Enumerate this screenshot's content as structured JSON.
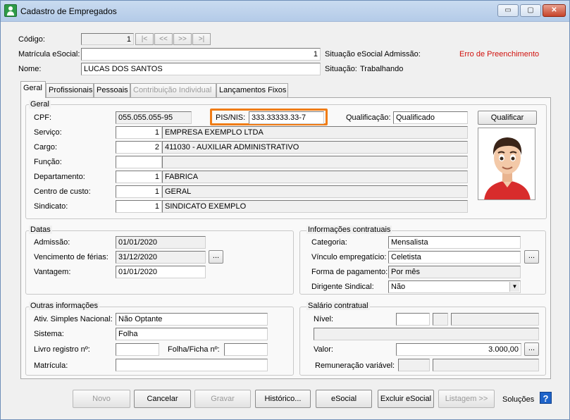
{
  "window": {
    "title": "Cadastro de Empregados",
    "controls": {
      "minimize": "▭",
      "maximize": "▢",
      "close": "✕"
    }
  },
  "header": {
    "codigo_label": "Código:",
    "codigo_value": "1",
    "nav": {
      "first": "|<",
      "prev": "<<",
      "next": ">>",
      "last": ">|"
    },
    "matricula_label": "Matrícula eSocial:",
    "matricula_value": "1",
    "situacao_esocial_label": "Situação eSocial Admissão:",
    "situacao_esocial_value": "Erro de Preenchimento",
    "nome_label": "Nome:",
    "nome_value": "LUCAS DOS SANTOS",
    "situacao_label": "Situação:",
    "situacao_value": "Trabalhando"
  },
  "tabs": [
    "Geral",
    "Profissionais",
    "Pessoais",
    "Contribuição Individual",
    "Lançamentos Fixos"
  ],
  "geral": {
    "title": "Geral",
    "cpf_label": "CPF:",
    "cpf_value": "055.055.055-95",
    "pis_label": "PIS/NIS:",
    "pis_value": "333.33333.33-7",
    "qualificacao_label": "Qualificação:",
    "qualificacao_value": "Qualificado",
    "qualificar_button": "Qualificar",
    "servico_label": "Serviço:",
    "servico_code": "1",
    "servico_name": "EMPRESA EXEMPLO LTDA",
    "cargo_label": "Cargo:",
    "cargo_code": "2",
    "cargo_name": "411030 - AUXILIAR ADMINISTRATIVO",
    "funcao_label": "Função:",
    "funcao_code": "",
    "funcao_name": "",
    "departamento_label": "Departamento:",
    "departamento_code": "1",
    "departamento_name": "FABRICA",
    "centro_label": "Centro de custo:",
    "centro_code": "1",
    "centro_name": "GERAL",
    "sindicato_label": "Sindicato:",
    "sindicato_code": "1",
    "sindicato_name": "SINDICATO EXEMPLO"
  },
  "datas": {
    "title": "Datas",
    "admissao_label": "Admissão:",
    "admissao_value": "01/01/2020",
    "ferias_label": "Vencimento de férias:",
    "ferias_value": "31/12/2020",
    "vantagem_label": "Vantagem:",
    "vantagem_value": "01/01/2020",
    "ellipsis": "..."
  },
  "contratuais": {
    "title": "Informações contratuais",
    "categoria_label": "Categoria:",
    "categoria_value": "Mensalista",
    "vinculo_label": "Vínculo empregatício:",
    "vinculo_value": "Celetista",
    "pagamento_label": "Forma de pagamento:",
    "pagamento_value": "Por mês",
    "dirigente_label": "Dirigente Sindical:",
    "dirigente_value": "Não"
  },
  "outras": {
    "title": "Outras informações",
    "simples_label": "Ativ. Simples Nacional:",
    "simples_value": "Não Optante",
    "sistema_label": "Sistema:",
    "sistema_value": "Folha",
    "livro_label": "Livro registro nº:",
    "livro_value": "",
    "folha_label": "Folha/Ficha nº:",
    "folha_value": "",
    "matricula_label": "Matrícula:",
    "matricula_value": ""
  },
  "salario": {
    "title": "Salário contratual",
    "nivel_label": "Nível:",
    "valor_label": "Valor:",
    "valor_value": "3.000,00",
    "remuneracao_label": "Remuneração variável:"
  },
  "footer": {
    "novo": "Novo",
    "cancelar": "Cancelar",
    "gravar": "Gravar",
    "historico": "Histórico...",
    "esocial": "eSocial",
    "excluir": "Excluir eSocial",
    "listagem": "Listagem >>",
    "solucoes": "Soluções",
    "help": "?"
  },
  "colors": {
    "highlight": "#f07c16",
    "error_text": "#d0110d"
  }
}
